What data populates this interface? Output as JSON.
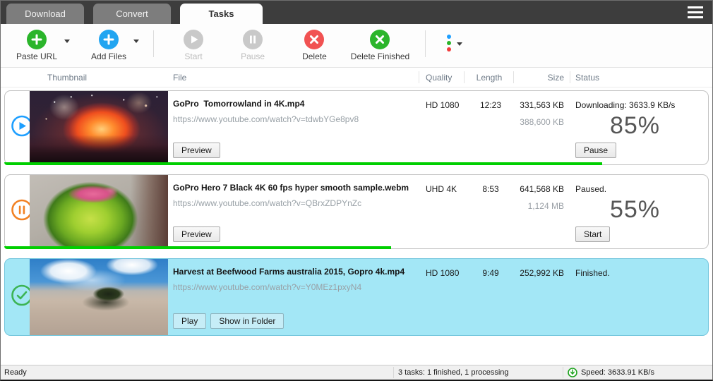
{
  "tabs": [
    {
      "label": "Download",
      "active": false
    },
    {
      "label": "Convert",
      "active": false
    },
    {
      "label": "Tasks",
      "active": true
    }
  ],
  "toolbar": {
    "paste_url_label": "Paste URL",
    "add_files_label": "Add Files",
    "start_label": "Start",
    "pause_label": "Pause",
    "delete_label": "Delete",
    "delete_finished_label": "Delete Finished"
  },
  "table": {
    "columns": {
      "thumbnail": "Thumbnail",
      "file": "File",
      "quality": "Quality",
      "length": "Length",
      "size": "Size",
      "status": "Status"
    }
  },
  "rows": [
    {
      "file": "GoPro  Tomorrowland in 4K.mp4",
      "url": "https://www.youtube.com/watch?v=tdwbYGe8pv8",
      "quality": "HD 1080",
      "length": "12:23",
      "size": "331,563 KB",
      "size_total": "388,600 KB",
      "status": "Downloading: 3633.9 KB/s",
      "percent": "85%",
      "progress": 85,
      "state": "downloading",
      "state_icon": "play-circle-icon",
      "thumbnail": "fireworks-show-thumbnail",
      "buttons": {
        "preview": "Preview",
        "action": "Pause"
      }
    },
    {
      "file": "GoPro Hero 7 Black 4K 60 fps hyper smooth sample.webm",
      "url": "https://www.youtube.com/watch?v=QBrxZDPYnZc",
      "quality": "UHD 4K",
      "length": "8:53",
      "size": "641,568 KB",
      "size_total": "1,124 MB",
      "status": "Paused.",
      "percent": "55%",
      "progress": 55,
      "state": "paused",
      "state_icon": "pause-circle-icon",
      "thumbnail": "flower-planter-street-thumbnail",
      "buttons": {
        "preview": "Preview",
        "action": "Start"
      }
    },
    {
      "file": "Harvest at Beefwood Farms australia 2015, Gopro 4k.mp4",
      "url": "https://www.youtube.com/watch?v=Y0MEz1pxyN4",
      "quality": "HD 1080",
      "length": "9:49",
      "size": "252,992 KB",
      "status": "Finished.",
      "state": "finished",
      "state_icon": "check-circle-icon",
      "thumbnail": "tractor-dusty-field-thumbnail",
      "selected": true,
      "buttons": {
        "play": "Play",
        "show_in_folder": "Show in Folder"
      }
    }
  ],
  "statusbar": {
    "ready": "Ready",
    "tasks": "3 tasks: 1 finished, 1 processing",
    "speed": "Speed: 3633.91 KB/s"
  },
  "colors": {
    "accent_green": "#2bb52b",
    "accent_blue": "#22a5f1",
    "accent_red": "#f15252",
    "accent_orange": "#f28123",
    "progress_green": "#00cf00",
    "selected_row_bg": "#a3e7f6",
    "titlebar_bg": "#3d3d3d",
    "tab_inactive_bg": "#7d7d7d"
  }
}
